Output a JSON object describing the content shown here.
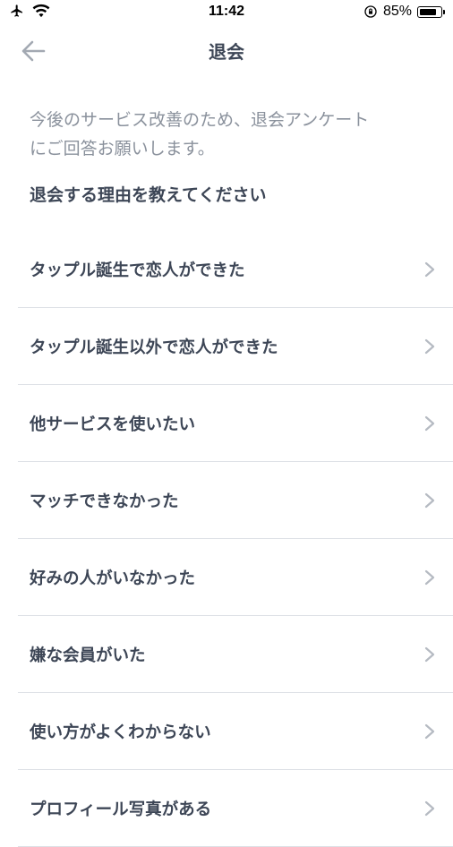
{
  "status_bar": {
    "time": "11:42",
    "battery_percent": "85%",
    "battery_level": 0.85
  },
  "nav": {
    "title": "退会"
  },
  "intro": {
    "line1": "今後のサービス改善のため、退会アンケート",
    "line2": "にご回答お願いします。"
  },
  "section_label": "退会する理由を教えてください",
  "reasons": [
    {
      "label": "タップル誕生で恋人ができた"
    },
    {
      "label": "タップル誕生以外で恋人ができた"
    },
    {
      "label": "他サービスを使いたい"
    },
    {
      "label": "マッチできなかった"
    },
    {
      "label": "好みの人がいなかった"
    },
    {
      "label": "嫌な会員がいた"
    },
    {
      "label": "使い方がよくわからない"
    },
    {
      "label": "プロフィール写真がある"
    }
  ],
  "colors": {
    "text": "#3d4656",
    "muted": "#8a919c",
    "divider": "#dde0e5",
    "chevron": "#b5bac2"
  }
}
